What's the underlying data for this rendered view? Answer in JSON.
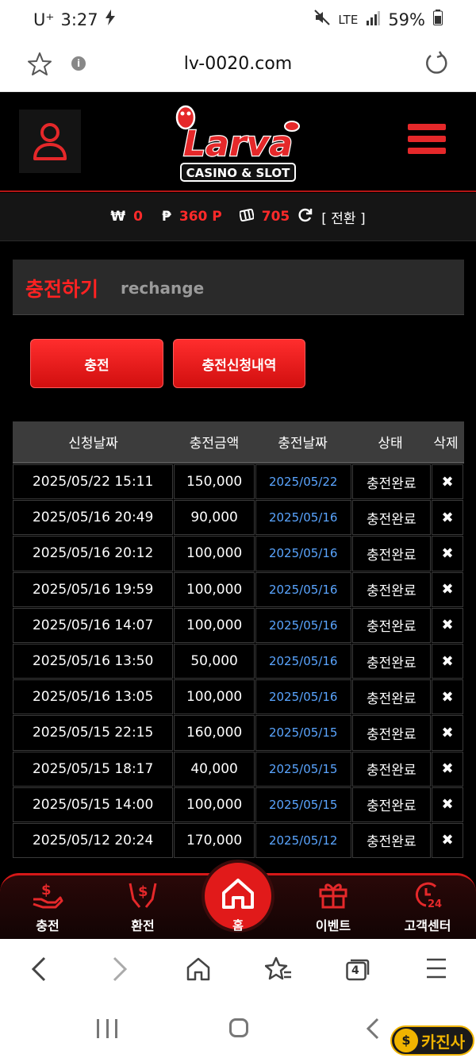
{
  "status_bar": {
    "carrier": "U⁺",
    "time": "3:27",
    "network": "LTE",
    "battery": "59%"
  },
  "browser": {
    "url": "lv-0020.com",
    "tab_count": "4"
  },
  "header": {
    "logo_title": "Larva",
    "logo_subtitle": "CASINO & SLOT"
  },
  "balance": {
    "won_symbol": "₩",
    "won_value": "0",
    "point_symbol": "₱",
    "point_value": "360 P",
    "chip_value": "705",
    "switch_label": "[ 전환 ]"
  },
  "page_title": {
    "korean": "충전하기",
    "english": "rechange"
  },
  "buttons": {
    "charge": "충전",
    "history": "충전신청내역"
  },
  "table": {
    "headers": [
      "신청날짜",
      "충전금액",
      "충전날짜",
      "상태",
      "삭제"
    ],
    "rows": [
      {
        "request_date": "2025/05/22 15:11",
        "amount": "150,000",
        "charge_date": "2025/05/22",
        "status": "충전완료",
        "delete": "✖"
      },
      {
        "request_date": "2025/05/16 20:49",
        "amount": "90,000",
        "charge_date": "2025/05/16",
        "status": "충전완료",
        "delete": "✖"
      },
      {
        "request_date": "2025/05/16 20:12",
        "amount": "100,000",
        "charge_date": "2025/05/16",
        "status": "충전완료",
        "delete": "✖"
      },
      {
        "request_date": "2025/05/16 19:59",
        "amount": "100,000",
        "charge_date": "2025/05/16",
        "status": "충전완료",
        "delete": "✖"
      },
      {
        "request_date": "2025/05/16 14:07",
        "amount": "100,000",
        "charge_date": "2025/05/16",
        "status": "충전완료",
        "delete": "✖"
      },
      {
        "request_date": "2025/05/16 13:50",
        "amount": "50,000",
        "charge_date": "2025/05/16",
        "status": "충전완료",
        "delete": "✖"
      },
      {
        "request_date": "2025/05/16 13:05",
        "amount": "100,000",
        "charge_date": "2025/05/16",
        "status": "충전완료",
        "delete": "✖"
      },
      {
        "request_date": "2025/05/15 22:15",
        "amount": "160,000",
        "charge_date": "2025/05/15",
        "status": "충전완료",
        "delete": "✖"
      },
      {
        "request_date": "2025/05/15 18:17",
        "amount": "40,000",
        "charge_date": "2025/05/15",
        "status": "충전완료",
        "delete": "✖"
      },
      {
        "request_date": "2025/05/15 14:00",
        "amount": "100,000",
        "charge_date": "2025/05/15",
        "status": "충전완료",
        "delete": "✖"
      },
      {
        "request_date": "2025/05/12 20:24",
        "amount": "170,000",
        "charge_date": "2025/05/12",
        "status": "충전완료",
        "delete": "✖"
      }
    ]
  },
  "bottom_nav": {
    "charge": "충전",
    "exchange": "환전",
    "home": "홈",
    "event": "이벤트",
    "support": "고객센터"
  },
  "watermark": {
    "text": "카진사"
  },
  "colors": {
    "accent": "#e5282a",
    "link": "#5aa5ff",
    "panel": "#2a2a2a"
  }
}
